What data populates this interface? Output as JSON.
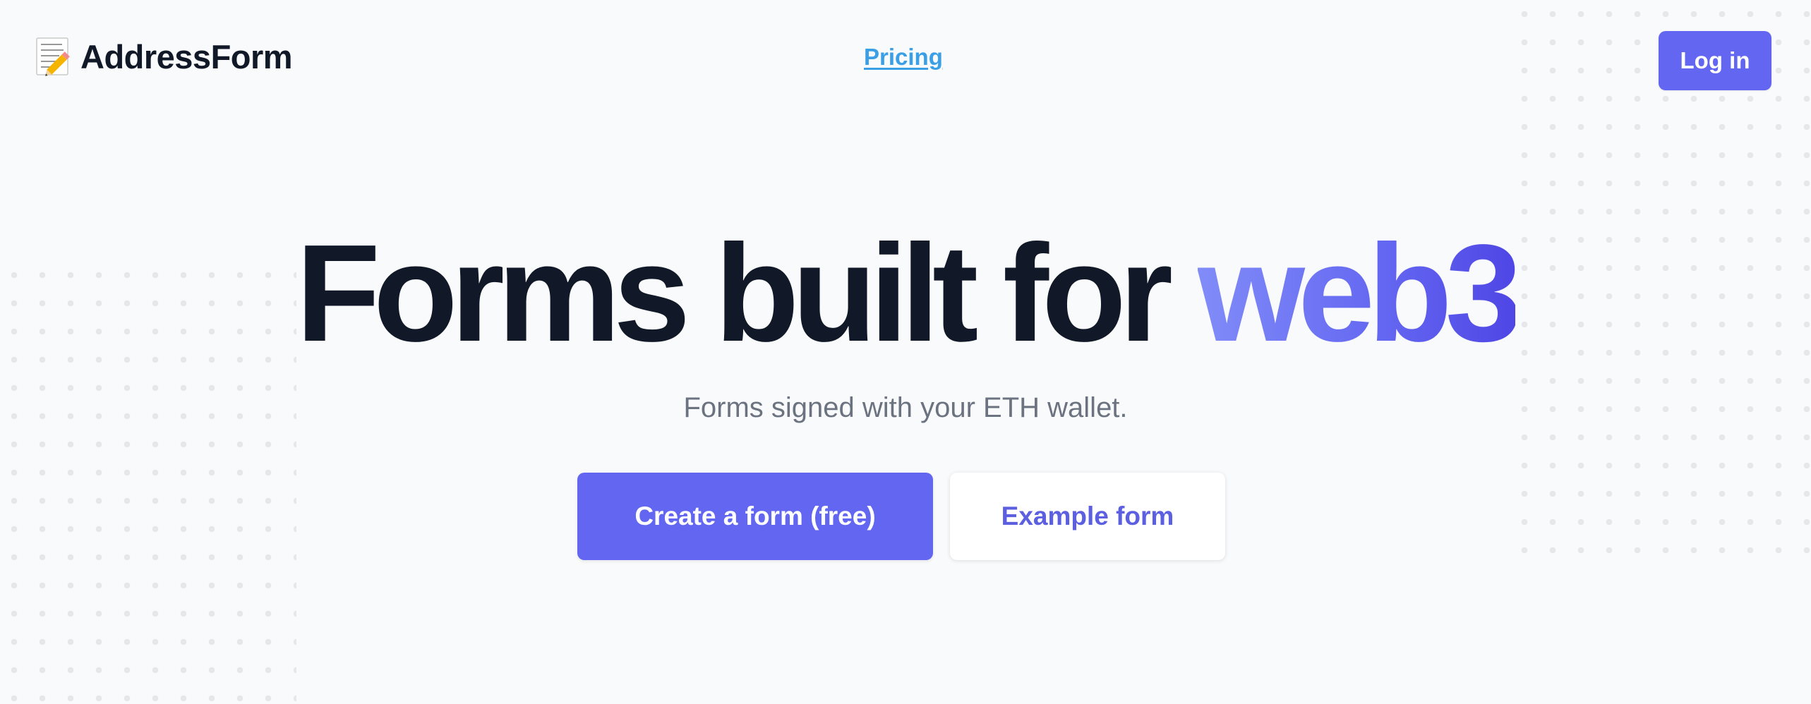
{
  "header": {
    "logo_icon": "memo-icon",
    "logo_text": "AddressForm",
    "nav_pricing": "Pricing",
    "login_label": "Log in"
  },
  "hero": {
    "title_main": "Forms built for",
    "title_accent": "web3",
    "subtitle": "Forms signed with your ETH wallet.",
    "primary_cta": "Create a form (free)",
    "secondary_cta": "Example form"
  },
  "colors": {
    "accent": "#6366f1",
    "accent_light": "#818cf8",
    "link": "#3b9fe6",
    "heading": "#111827",
    "muted": "#6b7280",
    "background": "#f9fafb"
  }
}
